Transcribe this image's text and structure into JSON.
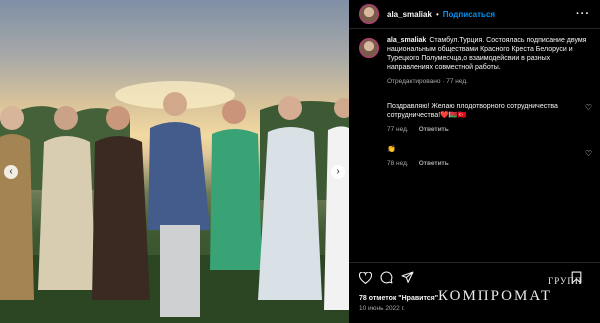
{
  "post": {
    "username": "ala_smaliak",
    "follow_label": "Подписаться",
    "separator": "•",
    "more_label": "···",
    "caption_text": "Стамбул.Турция. Состоялась подписание двумя национальным обществами Красного Креста Белоруси и Турецкого Полумесчца,о взаимодейсвии в разных направлениях совместной работы.",
    "caption_meta": "Отредактировано · 77 нед.",
    "comments": [
      {
        "text": "Поздравляю! Желаю плодотворного сотрудничества сотрудничества!❤️🇧🇾🇹🇷",
        "time": "77 нед.",
        "reply": "Ответить"
      },
      {
        "text": "👏",
        "time": "78 нед.",
        "reply": "Ответить"
      }
    ],
    "likes": "78 отметок \"Нравится\"",
    "date": "10 июнь 2022 г."
  },
  "watermark": {
    "main": "КОМПРОМАТ",
    "top": "ГРУПП"
  },
  "icons": [
    "heart-icon",
    "comment-icon",
    "share-icon",
    "bookmark-icon",
    "chevron-left-icon",
    "chevron-right-icon"
  ],
  "colors": {
    "follow": "#0095f6",
    "background": "#000000",
    "muted": "#a8a8a8"
  }
}
